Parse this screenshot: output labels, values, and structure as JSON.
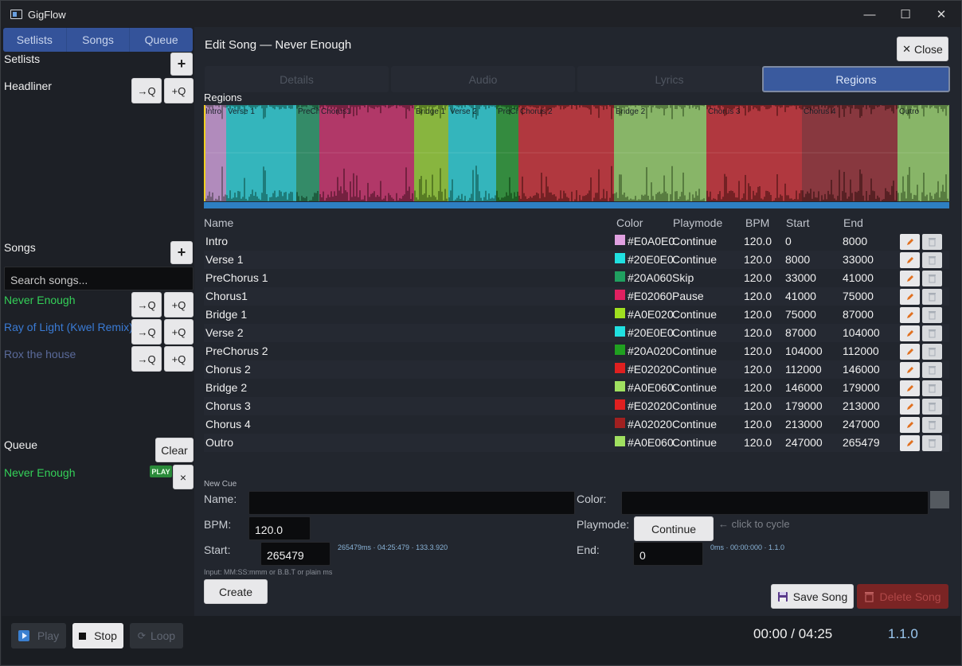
{
  "window": {
    "title": "GigFlow",
    "minimize": "—",
    "maximize": "☐",
    "close": "✕"
  },
  "sidebar": {
    "tabs": [
      "Setlists",
      "Songs",
      "Queue"
    ],
    "setlists_label": "Setlists",
    "add": "+",
    "setlist_item": "Headliner",
    "to_q": "→Q",
    "plus_q": "+Q",
    "songs_label": "Songs",
    "search_placeholder": "Search songs...",
    "songs": [
      {
        "name": "Never Enough",
        "color": "#34d058"
      },
      {
        "name": "Ray of Light (Kwel Remix)",
        "color": "#3a7bd5"
      },
      {
        "name": "Rox the house",
        "color": "#5a6a9a"
      }
    ],
    "queue_label": "Queue",
    "clear": "Clear",
    "queue_item": "Never Enough",
    "play_badge": "PLAY",
    "remove": "×"
  },
  "editor": {
    "heading": "Edit Song — Never Enough",
    "close": "Close",
    "close_icon": "✕",
    "tabs": [
      "Details",
      "Audio",
      "Lyrics",
      "Regions"
    ],
    "active_tab": "Regions",
    "regions_label": "Regions",
    "columns": [
      "Name",
      "Color",
      "Playmode",
      "BPM",
      "Start",
      "End"
    ],
    "regions": [
      {
        "name": "Intro",
        "color": "#E0A0E0",
        "playmode": "Continue",
        "bpm": "120.0",
        "start": "0",
        "end": "8000"
      },
      {
        "name": "Verse 1",
        "color": "#20E0E0",
        "playmode": "Continue",
        "bpm": "120.0",
        "start": "8000",
        "end": "33000"
      },
      {
        "name": "PreChorus 1",
        "color": "#20A060",
        "playmode": "Skip",
        "bpm": "120.0",
        "start": "33000",
        "end": "41000"
      },
      {
        "name": "Chorus1",
        "color": "#E02060",
        "playmode": "Pause",
        "bpm": "120.0",
        "start": "41000",
        "end": "75000"
      },
      {
        "name": "Bridge 1",
        "color": "#A0E020",
        "playmode": "Continue",
        "bpm": "120.0",
        "start": "75000",
        "end": "87000"
      },
      {
        "name": "Verse 2",
        "color": "#20E0E0",
        "playmode": "Continue",
        "bpm": "120.0",
        "start": "87000",
        "end": "104000"
      },
      {
        "name": "PreChorus 2",
        "color": "#20A020",
        "playmode": "Continue",
        "bpm": "120.0",
        "start": "104000",
        "end": "112000"
      },
      {
        "name": "Chorus 2",
        "color": "#E02020",
        "playmode": "Continue",
        "bpm": "120.0",
        "start": "112000",
        "end": "146000"
      },
      {
        "name": "Bridge 2",
        "color": "#A0E060",
        "playmode": "Continue",
        "bpm": "120.0",
        "start": "146000",
        "end": "179000"
      },
      {
        "name": "Chorus 3",
        "color": "#E02020",
        "playmode": "Continue",
        "bpm": "120.0",
        "start": "179000",
        "end": "213000"
      },
      {
        "name": "Chorus 4",
        "color": "#A02020",
        "playmode": "Continue",
        "bpm": "120.0",
        "start": "213000",
        "end": "247000"
      },
      {
        "name": "Outro",
        "color": "#A0E060",
        "playmode": "Continue",
        "bpm": "120.0",
        "start": "247000",
        "end": "265479"
      }
    ],
    "new_cue": {
      "title": "New Cue",
      "name_label": "Name:",
      "name_value": "",
      "color_label": "Color:",
      "color_value": "",
      "bpm_label": "BPM:",
      "bpm_value": "120.0",
      "playmode_label": "Playmode:",
      "playmode_value": "Continue",
      "cycle_hint": "← click to cycle",
      "start_label": "Start:",
      "start_value": "265479",
      "start_hint": "265479ms · 04:25:479 · 133.3.920",
      "end_label": "End:",
      "end_value": "0",
      "end_hint": "0ms · 00:00:000 · 1.1.0",
      "input_hint": "Input: MM:SS:mmm or B.B.T or plain ms",
      "create": "Create"
    },
    "save": "Save Song",
    "delete": "Delete Song"
  },
  "transport": {
    "play": "Play",
    "stop": "Stop",
    "loop": "Loop",
    "time": "00:00 / 04:25",
    "position": "1.1.0"
  }
}
